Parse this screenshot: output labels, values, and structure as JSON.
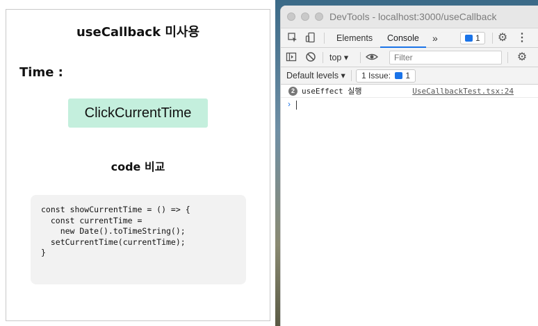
{
  "app": {
    "heading": "useCallback 미사용",
    "time_label": "Time :",
    "button_label": "ClickCurrentTime",
    "code_heading": "code 비교",
    "code": "const showCurrentTime = () => {\n  const currentTime =\n    new Date().toTimeString();\n  setCurrentTime(currentTime);\n}"
  },
  "devtools": {
    "window_title": "DevTools - localhost:3000/useCallback",
    "tabs": [
      {
        "label": "Elements",
        "active": false
      },
      {
        "label": "Console",
        "active": true
      }
    ],
    "more_tabs": "»",
    "issues_badge_count": "1",
    "context": "top",
    "filter_placeholder": "Filter",
    "levels_label": "Default levels",
    "issues_label": "1 Issue:",
    "issues_count": "1",
    "logs": [
      {
        "count": "2",
        "message": "useEffect 실행",
        "source": "UseCallbackTest.tsx:24"
      }
    ],
    "prompt_symbol": "›"
  },
  "colors": {
    "button_bg": "#c4efdd",
    "code_bg": "#f2f2f2",
    "accent": "#1a73e8"
  }
}
